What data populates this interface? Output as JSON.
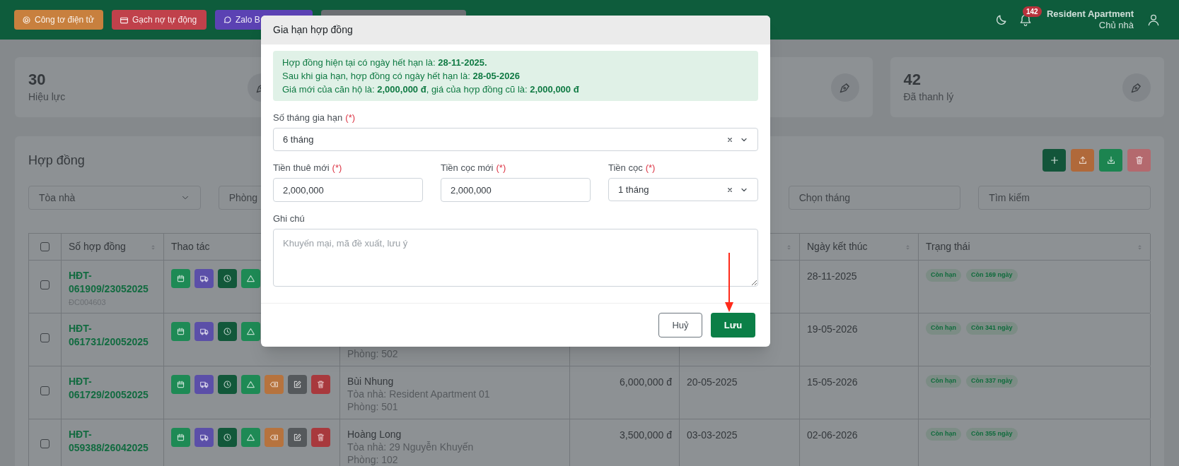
{
  "topbar": {
    "buttons": [
      {
        "label": "Công tơ điện tử",
        "color": "#c8803e"
      },
      {
        "label": "Gạch nợ tự động",
        "color": "#c0414b"
      },
      {
        "label": "Zalo B",
        "color": "#5b42b3"
      },
      {
        "color": "#6c6f73"
      }
    ],
    "notification_count": "142",
    "user_name": "Resident Apartment",
    "user_role": "Chủ nhà"
  },
  "stats": [
    {
      "kind": "full",
      "value": "30",
      "label": "Hiệu lực"
    },
    {
      "kind": "partial"
    },
    {
      "kind": "full",
      "value": "42",
      "label": "Đã thanh lý"
    }
  ],
  "contracts": {
    "title": "Hợp đồng",
    "toolbar": [
      {
        "kind": "add"
      },
      {
        "kind": "upload"
      },
      {
        "kind": "download"
      },
      {
        "kind": "delete"
      }
    ],
    "filters": [
      {
        "placeholder": "Tòa nhà",
        "kind": "select"
      },
      {
        "placeholder": "Phòng",
        "kind": "partial"
      },
      {
        "placeholder": "Chọn tháng",
        "kind": "input"
      },
      {
        "placeholder": "Tìm kiếm",
        "kind": "input"
      }
    ],
    "columns": [
      {
        "kind": "checkbox",
        "checked": false
      },
      {
        "label": "Số hợp đồng",
        "sortable": true
      },
      {
        "label": "Thao tác",
        "sortable": false
      },
      {},
      {},
      {
        "sortable": true
      },
      {
        "label": "Ngày kết thúc",
        "sortable": true
      },
      {
        "label": "Trạng thái",
        "sortable": true
      }
    ],
    "rows": [
      {
        "checked": false,
        "number": "HĐT-061909/23052025",
        "code": "ĐC004603",
        "actions": [
          {
            "kind": "calendar"
          },
          {
            "kind": "truck"
          },
          {
            "kind": "clock"
          },
          {
            "kind": "triangle"
          }
        ],
        "end": "28-11-2025",
        "tags": [
          "Còn hạn",
          "Còn 169 ngày"
        ]
      },
      {
        "checked": false,
        "number": "HĐT-061731/20052025",
        "actions": [
          {
            "kind": "calendar"
          },
          {
            "kind": "truck"
          },
          {
            "kind": "clock"
          },
          {
            "kind": "triangle"
          }
        ],
        "room": "Phòng: 502",
        "end": "19-05-2026",
        "tags": [
          "Còn hạn",
          "Còn 341 ngày"
        ]
      },
      {
        "checked": false,
        "number": "HĐT-061729/20052025",
        "actions": [
          {
            "kind": "calendar"
          },
          {
            "kind": "truck"
          },
          {
            "kind": "clock"
          },
          {
            "kind": "triangle"
          },
          {
            "kind": "erase"
          },
          {
            "kind": "edit"
          },
          {
            "kind": "trash"
          }
        ],
        "tenant": "Bùi Nhung",
        "building": "Tòa nhà: Resident Apartment 01",
        "room": "Phòng: 501",
        "price": "6,000,000 đ",
        "start": "20-05-2025",
        "end": "15-05-2026",
        "tags": [
          "Còn hạn",
          "Còn 337 ngày"
        ]
      },
      {
        "checked": false,
        "number": "HĐT-059388/26042025",
        "actions": [
          {
            "kind": "calendar"
          },
          {
            "kind": "truck"
          },
          {
            "kind": "clock"
          },
          {
            "kind": "triangle"
          },
          {
            "kind": "erase"
          },
          {
            "kind": "edit"
          },
          {
            "kind": "trash"
          }
        ],
        "tenant": "Hoàng Long",
        "building": "Tòa nhà: 29 Nguyễn Khuyến",
        "room": "Phòng: 102",
        "price": "3,500,000 đ",
        "start": "03-03-2025",
        "end": "02-06-2026",
        "tags": [
          "Còn hạn",
          "Còn 355 ngày"
        ]
      }
    ]
  },
  "modal": {
    "title": "Gia hạn hợp đồng",
    "notice": [
      "Hợp đồng hiện tại có ngày hết hạn là: **28-11-2025.**",
      "Sau khi gia hạn, hợp đồng có ngày hết hạn là: **28-05-2026**",
      "Giá mới của căn hộ là: **2,000,000 đ**, giá của hợp đồng cũ là: **2,000,000 đ**"
    ],
    "fields": [
      {
        "kind": "select",
        "label": "Số tháng gia hạn",
        "required_mark": "(*)",
        "value": "6 tháng"
      },
      {
        "kind": "input",
        "label": "Tiền thuê mới",
        "required_mark": "(*)",
        "value": "2,000,000"
      },
      {
        "kind": "input",
        "label": "Tiền cọc mới",
        "required_mark": "(*)",
        "value": "2,000,000"
      },
      {
        "kind": "select",
        "label": "Tiền cọc",
        "required_mark": "(*)",
        "value": "1 tháng"
      },
      {
        "kind": "textarea",
        "label": "Ghi chú",
        "placeholder": "Khuyến mại, mã đề xuất, lưu ý"
      }
    ],
    "buttons": [
      {
        "label": "Huỷ",
        "kind": "secondary"
      },
      {
        "label": "Lưu",
        "kind": "primary"
      }
    ]
  }
}
